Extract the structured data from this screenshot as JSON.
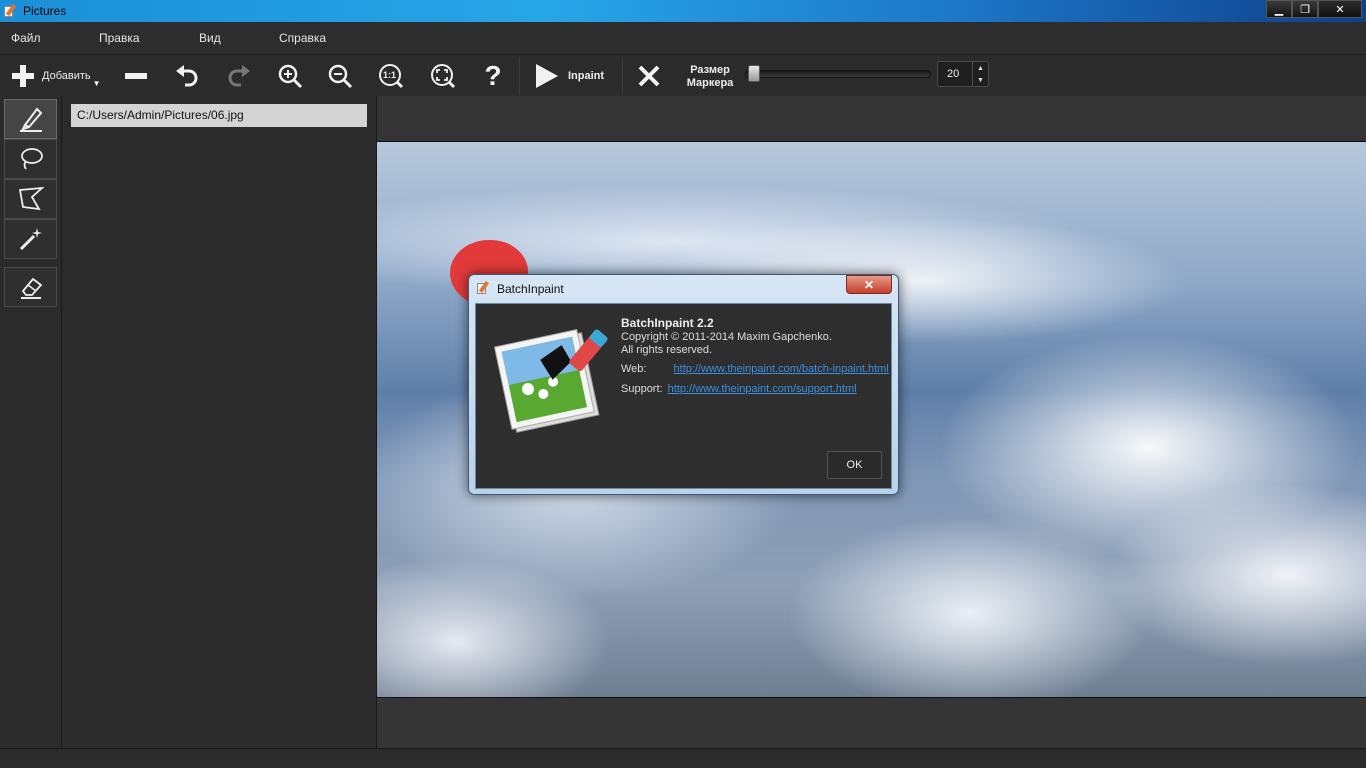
{
  "window": {
    "title": "Pictures"
  },
  "menu": {
    "items": [
      "Файл",
      "Правка",
      "Вид",
      "Справка"
    ]
  },
  "toolbar": {
    "add_label": "Добавить",
    "inpaint_label": "Inpaint",
    "marker_size_label_1": "Размер",
    "marker_size_label_2": "Маркера",
    "marker_size_value": "20",
    "marker_size_fraction": 0.02,
    "zoom_1to1_label": "1:1",
    "help_label": "?"
  },
  "files": [
    "C:/Users/Admin/Pictures/06.jpg"
  ],
  "dialog": {
    "title": "BatchInpaint",
    "heading": "BatchInpaint 2.2",
    "copyright": "Copyright © 2011-2014 Maxim Gapchenko.",
    "rights": "All rights reserved.",
    "web_label": "Web:",
    "web_url": "http://www.theinpaint.com/batch-inpaint.html",
    "support_label": "Support:",
    "support_url": "http://www.theinpaint.com/support.html",
    "ok_label": "OK"
  },
  "colors": {
    "accent": "#1b8fd6",
    "marker": "#e23a3a",
    "link": "#3d8fe0"
  }
}
